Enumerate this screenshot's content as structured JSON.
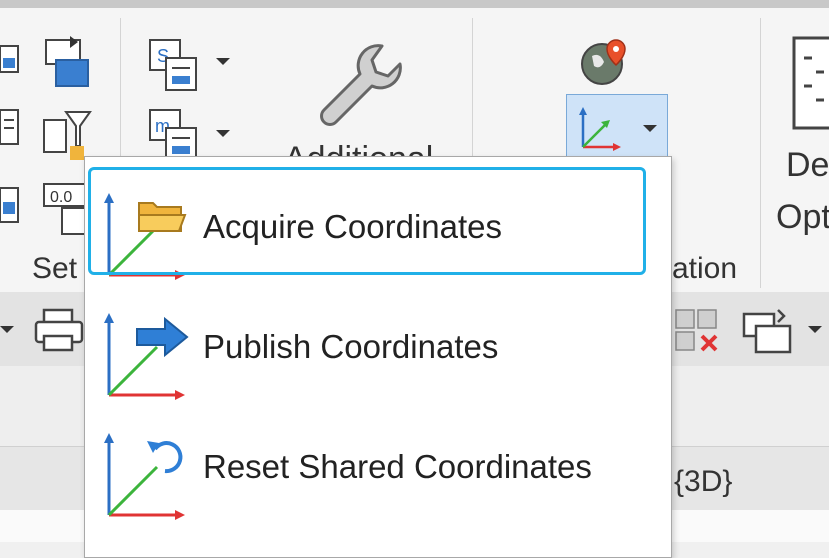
{
  "ribbon": {
    "setup_panel_label": "Set",
    "additional_label": "Additional",
    "location_panel_label": "ation",
    "design_label_line1": "De",
    "design_label_line2": "Opt"
  },
  "view": {
    "tab_label": "{3D}"
  },
  "menu": {
    "items": [
      {
        "label": "Acquire Coordinates",
        "icon": "acquire-coordinates-icon"
      },
      {
        "label": "Publish Coordinates",
        "icon": "publish-coordinates-icon"
      },
      {
        "label": "Reset Shared Coordinates",
        "icon": "reset-coordinates-icon"
      }
    ]
  },
  "colors": {
    "highlight_border": "#20b0e8",
    "axis_blue": "#2b6fc4",
    "axis_green": "#3cb43c",
    "axis_red": "#e03434",
    "folder": "#f0b43c",
    "arrow_blue": "#2f7fd6"
  }
}
